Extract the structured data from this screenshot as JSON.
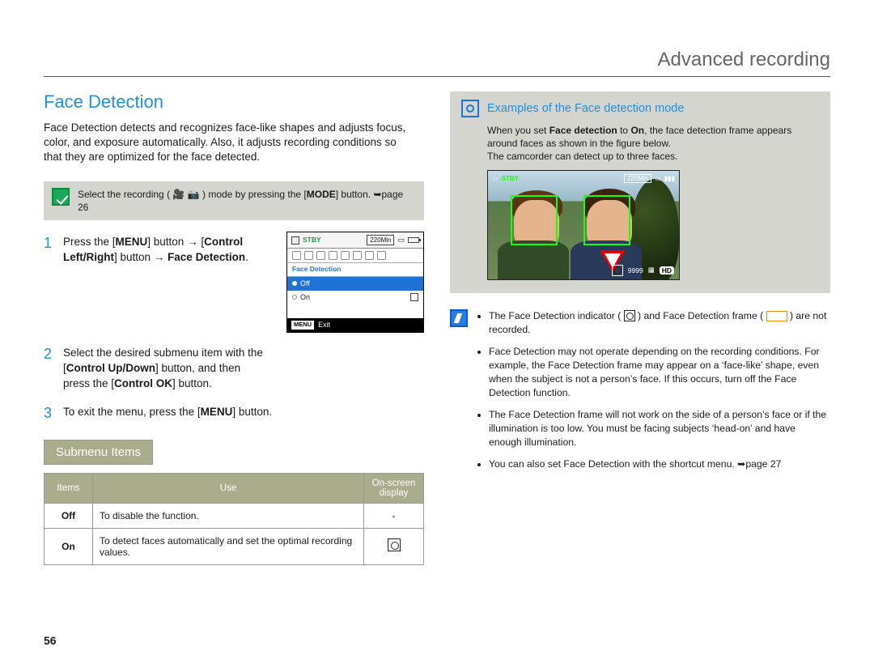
{
  "header": {
    "title": "Advanced recording"
  },
  "page_number": "56",
  "left": {
    "section_title": "Face Detection",
    "intro": "Face Detection detects and recognizes face-like shapes and adjusts focus, color, and exposure automatically. Also, it adjusts recording conditions so that they are optimized for the face detected.",
    "mode_note_prefix": "Select the recording (",
    "mode_note_mid": ") mode by pressing the [",
    "mode_note_bold": "MODE",
    "mode_note_suffix": "] button. ",
    "mode_note_page": "page 26",
    "step1": {
      "a": "Press the [",
      "menu": "MENU",
      "b": "] button → [",
      "ctrl": "Control Left/Right",
      "c": "] button → ",
      "fd": "Face Detection",
      "d": "."
    },
    "step2": {
      "a": "Select the desired submenu item with the [",
      "ctrl": "Control Up/Down",
      "b": "] button, and then press the [",
      "ok": "Control OK",
      "c": "] button."
    },
    "step3": {
      "a": "To exit the menu, press the [",
      "menu": "MENU",
      "b": "] button."
    },
    "lcd": {
      "stby": "STBY",
      "time": "220Min",
      "label": "Face Detection",
      "off": "Off",
      "on": "On",
      "menu": "MENU",
      "exit": "Exit"
    },
    "submenu_title": "Submenu Items",
    "table": {
      "h1": "Items",
      "h2": "Use",
      "h3": "On-screen display",
      "r1c1": "Off",
      "r1c2": "To disable the function.",
      "r1c3": "-",
      "r2c1": "On",
      "r2c2": "To detect faces automatically and set the optimal recording values."
    }
  },
  "right": {
    "ex_title": "Examples of the Face detection mode",
    "ex_body_a": "When you set ",
    "ex_body_bold1": "Face detection",
    "ex_body_b": " to ",
    "ex_body_bold2": "On",
    "ex_body_c": ", the face detection frame appears around faces as shown in the figure below.",
    "ex_body_d": "The camcorder can detect up to three faces.",
    "photo": {
      "stby": "STBY",
      "time": "220Min",
      "count": "9999",
      "hd": "HD"
    },
    "bullets": {
      "b1a": "The Face Detection indicator (",
      "b1b": ") and Face Detection frame (",
      "b1c": ") are not recorded.",
      "b2": "Face Detection may not operate depending on the recording conditions. For example, the Face Detection frame may appear on a ‘face-like’ shape, even when the subject is not a person’s face. If this occurs, turn off the Face Detection function.",
      "b3": "The Face Detection frame will not work on the side of a person’s face or if the illumination is too low. You must be facing subjects ‘head-on’ and have enough illumination.",
      "b4a": "You can also set Face Detection with the shortcut menu. ",
      "b4b": "page 27"
    }
  }
}
